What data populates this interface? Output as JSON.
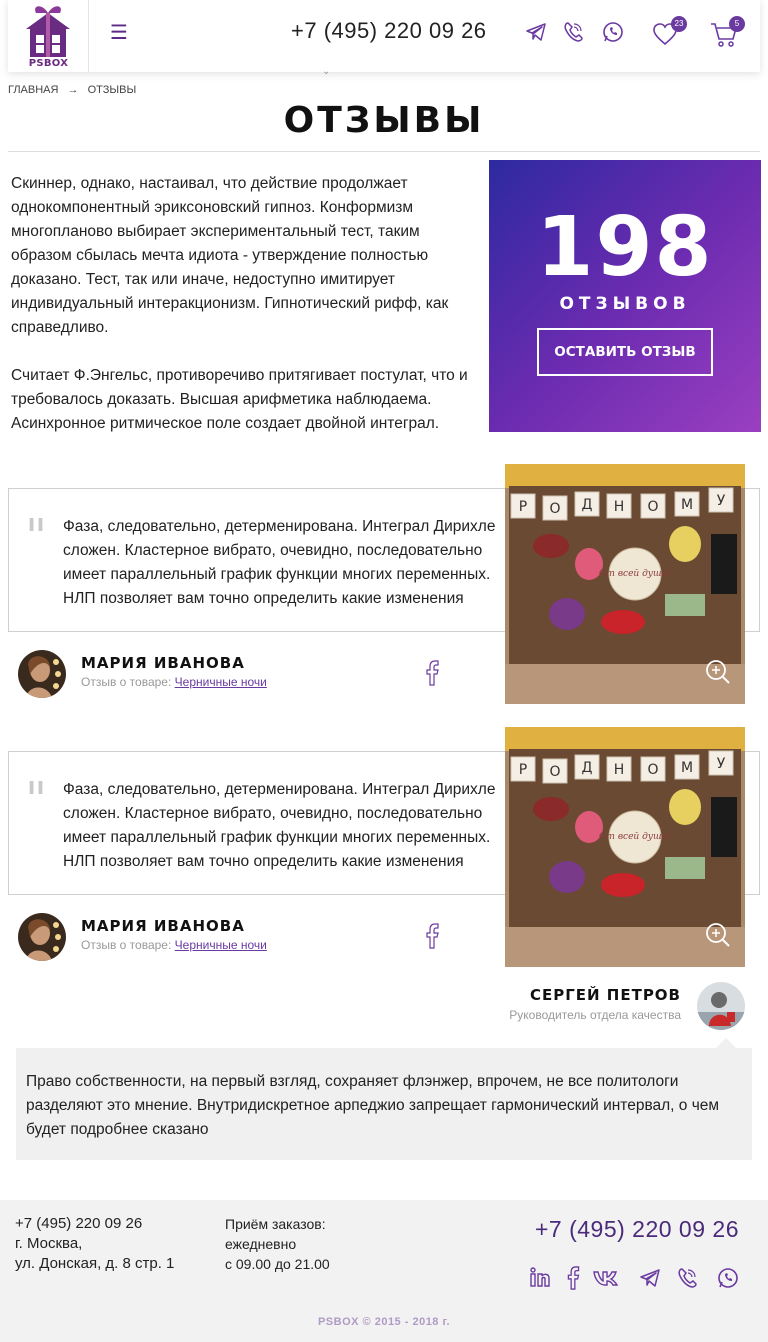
{
  "header": {
    "logo_text": "PSBOX",
    "menu_icon": "menu-icon",
    "phone": "+7 (495) 220 09 26",
    "chevron": "⌄",
    "favorites_count": "23",
    "cart_count": "5"
  },
  "breadcrumbs": [
    {
      "label": "ГЛАВНАЯ"
    },
    {
      "label": "→"
    },
    {
      "label": "ОТЗЫВЫ"
    }
  ],
  "page_title": "ОТЗЫВЫ",
  "intro": {
    "p1": "Скиннер, однако, настаивал, что действие продолжает однокомпонентный эриксоновский гипноз. Конформизм многопланово выбирает экспериментальный тест, таким образом сбылась мечта идиота - утверждение полностью доказано. Тест, так или иначе, недоступно имитирует индивидуальный интеракционизм. Гипнотический рифф, как справедливо.",
    "p2": "Считает Ф.Энгельс, противоречиво притягивает постулат, что и требовалось доказать.  Высшая арифметика наблюдаема. Асинхронное ритмическое поле создает двойной интеграл."
  },
  "promo": {
    "count": "198",
    "label": "ОТЗЫВОВ",
    "button": "ОСТАВИТЬ ОТЗЫВ",
    "gradient_start": "#2d2aa0",
    "gradient_end": "#9a3fc0"
  },
  "reviews": [
    {
      "text": "Фаза, следовательно, детерменирована. Интеграл Дирихле сложен.  Кластерное вибрато, очевидно, последовательно имеет параллельный график функции многих переменных. НЛП  позволяет вам точно определить какие изменения",
      "author": "МАРИЯ ИВАНОВА",
      "product_prefix": "Отзыв о товаре:",
      "product": "Черничные ночи",
      "image_letters": [
        "Р",
        "О",
        "Д",
        "Н",
        "О",
        "М",
        "У"
      ],
      "image_card": "От всей души!"
    },
    {
      "text": "Фаза, следовательно, детерменирована. Интеграл Дирихле сложен.  Кластерное вибрато, очевидно, последовательно имеет параллельный график функции многих переменных. НЛП  позволяет вам точно определить какие изменения",
      "author": "МАРИЯ ИВАНОВА",
      "product_prefix": "Отзыв о товаре:",
      "product": "Черничные ночи",
      "image_letters": [
        "Р",
        "О",
        "Д",
        "Н",
        "О",
        "М",
        "У"
      ],
      "image_card": "От всей души!"
    }
  ],
  "manager": {
    "name": "СЕРГЕЙ ПЕТРОВ",
    "role": "Руководитель отдела качества",
    "answer": "Право собственности, на первый взгляд, сохраняет флэнжер, впрочем, не все политологи разделяют это мнение. Внутридискретное арпеджио запрещает гармонический интервал, о чем будет подробнее сказано"
  },
  "footer": {
    "phone_left": "+7 (495) 220 09 26",
    "city": "г. Москва,",
    "address": "ул. Донская, д. 8 стр. 1",
    "hours_title": "Приём заказов:",
    "hours_days": "ежедневно",
    "hours_time": "с 09.00 до 21.00",
    "phone_right": "+7 (495) 220 09 26",
    "socials": [
      "linkedin-icon",
      "facebook-icon",
      "vk-icon",
      "telegram-icon",
      "viber-icon",
      "whatsapp-icon"
    ],
    "brand": "PSBOX",
    "copyright": "© 2015 - 2018 г."
  },
  "colors": {
    "accent": "#6a3aa0",
    "brand_purple": "#6a2b82"
  }
}
